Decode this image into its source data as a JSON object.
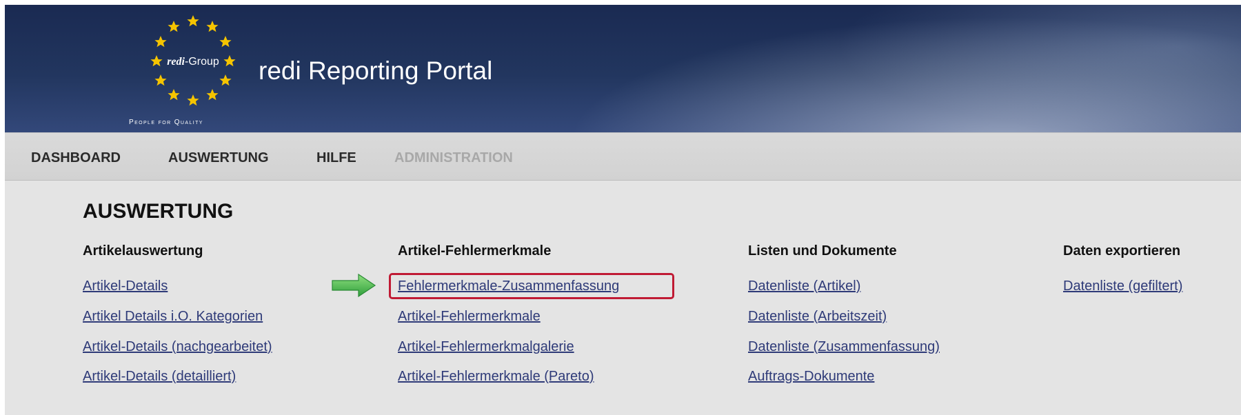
{
  "header": {
    "logo_text": "redi",
    "logo_suffix": "-Group",
    "tagline": "People for Quality",
    "title": "redi Reporting Portal"
  },
  "nav": {
    "items": [
      {
        "label": "DASHBOARD",
        "enabled": true
      },
      {
        "label": "AUSWERTUNG",
        "enabled": true
      },
      {
        "label": "HILFE",
        "enabled": true
      },
      {
        "label": "ADMINISTRATION",
        "enabled": false
      }
    ]
  },
  "main": {
    "title": "AUSWERTUNG",
    "columns": [
      {
        "heading": "Artikelauswertung",
        "links": [
          "Artikel-Details",
          "Artikel Details i.O. Kategorien",
          "Artikel-Details (nachgearbeitet)",
          "Artikel-Details (detailliert)"
        ]
      },
      {
        "heading": "Artikel-Fehlermerkmale",
        "links": [
          "Fehlermerkmale-Zusammenfassung",
          "Artikel-Fehlermerkmale",
          "Artikel-Fehlermerkmalgalerie",
          "Artikel-Fehlermerkmale (Pareto)"
        ]
      },
      {
        "heading": "Listen und Dokumente",
        "links": [
          "Datenliste (Artikel)",
          "Datenliste (Arbeitszeit)",
          "Datenliste (Zusammenfassung)",
          "Auftrags-Dokumente"
        ]
      },
      {
        "heading": "Daten exportieren",
        "links": [
          "Datenliste (gefiltert)"
        ]
      }
    ]
  },
  "annotations": {
    "arrow_icon": "green-arrow-right-icon",
    "highlight_color": "#c01a34",
    "arrow_color": "#3fb548"
  },
  "colors": {
    "header_bg": "#1a2a52",
    "nav_bg": "#d6d6d6",
    "content_bg": "#e4e4e4",
    "link": "#2e3a78"
  }
}
